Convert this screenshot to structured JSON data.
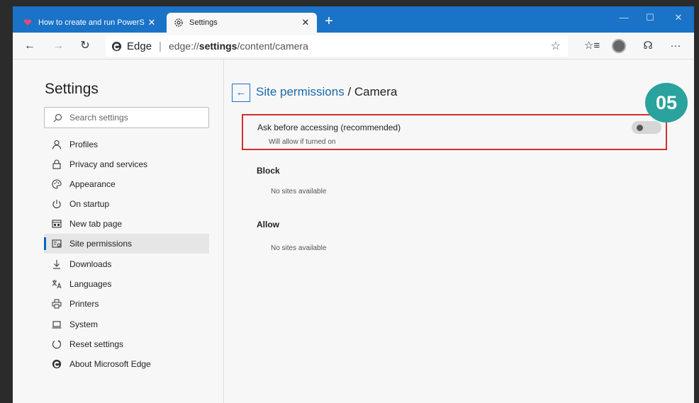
{
  "tabs": [
    {
      "title": "How to create and run PowerShe",
      "close": "✕"
    },
    {
      "title": "Settings",
      "close": "✕"
    }
  ],
  "new_tab": "+",
  "window_controls": {
    "minimize": "—",
    "maximize": "☐",
    "close": "✕"
  },
  "toolbar": {
    "back": "←",
    "forward": "→",
    "refresh": "↻",
    "site_name": "Edge",
    "separator": "|",
    "url_prefix": "edge://",
    "url_strong": "settings",
    "url_rest": "/content/camera",
    "favorite": "☆",
    "collections": "☆≡",
    "feedback": "☊",
    "more": "···"
  },
  "sidebar": {
    "title": "Settings",
    "search_placeholder": "Search settings",
    "items": [
      {
        "label": "Profiles",
        "icon": "profile-icon"
      },
      {
        "label": "Privacy and services",
        "icon": "lock-icon"
      },
      {
        "label": "Appearance",
        "icon": "palette-icon"
      },
      {
        "label": "On startup",
        "icon": "power-icon"
      },
      {
        "label": "New tab page",
        "icon": "new-tab-page-icon"
      },
      {
        "label": "Site permissions",
        "icon": "site-permissions-icon"
      },
      {
        "label": "Downloads",
        "icon": "download-icon"
      },
      {
        "label": "Languages",
        "icon": "languages-icon"
      },
      {
        "label": "Printers",
        "icon": "printer-icon"
      },
      {
        "label": "System",
        "icon": "laptop-icon"
      },
      {
        "label": "Reset settings",
        "icon": "reset-icon"
      },
      {
        "label": "About Microsoft Edge",
        "icon": "edge-logo-icon"
      }
    ]
  },
  "main": {
    "back": "←",
    "breadcrumb_link": "Site permissions",
    "breadcrumb_sep": " / ",
    "breadcrumb_current": "Camera",
    "ask_label": "Ask before accessing (recommended)",
    "ask_sub": "Will allow if turned on",
    "toggle_on": false,
    "block_heading": "Block",
    "block_empty": "No sites available",
    "allow_heading": "Allow",
    "allow_empty": "No sites available"
  },
  "step_badge": "05",
  "colors": {
    "titlebar": "#1a73c7",
    "accent_link": "#1a6aa8",
    "highlight_border": "#d32f2f",
    "badge": "#2aa29d"
  }
}
